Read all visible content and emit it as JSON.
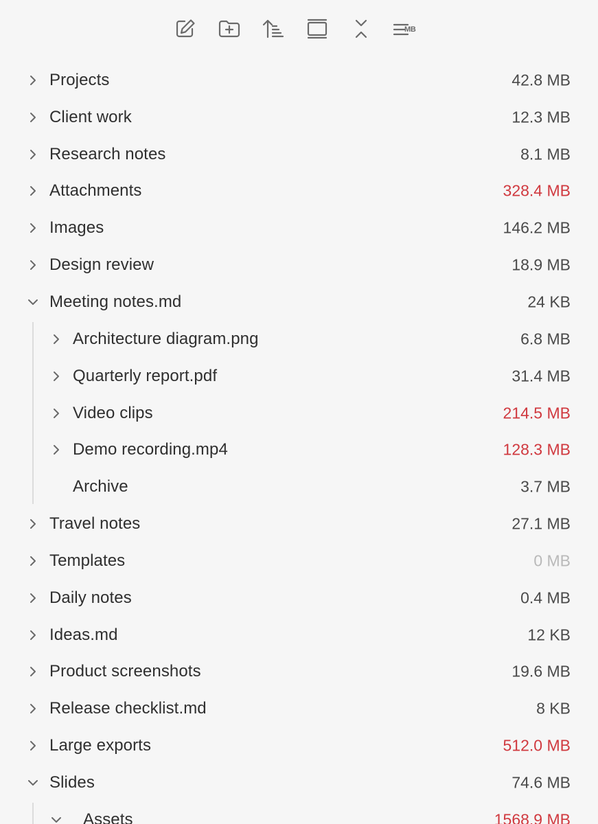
{
  "toolbar": {
    "buttons": [
      {
        "name": "new-note-button",
        "icon": "pencil-square-icon"
      },
      {
        "name": "new-folder-button",
        "icon": "folder-plus-icon"
      },
      {
        "name": "sort-button",
        "icon": "sort-ascending-icon"
      },
      {
        "name": "toggle-view-button",
        "icon": "panel-icon"
      },
      {
        "name": "collapse-all-button",
        "icon": "collapse-icon"
      },
      {
        "name": "size-display-button",
        "icon": "list-mb-icon",
        "badge": "MB"
      }
    ]
  },
  "colors": {
    "background": "#f6f6f6",
    "text": "#2f2f2f",
    "size_normal": "#4a4a4a",
    "size_large": "#d0393f",
    "size_empty": "#b9b9b9",
    "icon": "#6a6a6a"
  },
  "tree": {
    "items": [
      {
        "label": "Projects",
        "size": "42.8 MB",
        "depth": 0,
        "chevron": "right",
        "status": "normal"
      },
      {
        "label": "Client work",
        "size": "12.3 MB",
        "depth": 0,
        "chevron": "right",
        "status": "normal"
      },
      {
        "label": "Research notes",
        "size": "8.1 MB",
        "depth": 0,
        "chevron": "right",
        "status": "normal"
      },
      {
        "label": "Attachments",
        "size": "328.4 MB",
        "depth": 0,
        "chevron": "right",
        "status": "large"
      },
      {
        "label": "Images",
        "size": "146.2 MB",
        "depth": 0,
        "chevron": "right",
        "status": "normal"
      },
      {
        "label": "Design review",
        "size": "18.9 MB",
        "depth": 0,
        "chevron": "right",
        "status": "normal"
      },
      {
        "label": "Meeting notes.md",
        "size": "24 KB",
        "depth": 0,
        "chevron": "down",
        "status": "normal"
      },
      {
        "label": "Architecture diagram.png",
        "size": "6.8 MB",
        "depth": 1,
        "chevron": "right",
        "status": "normal"
      },
      {
        "label": "Quarterly report.pdf",
        "size": "31.4 MB",
        "depth": 1,
        "chevron": "right",
        "status": "normal"
      },
      {
        "label": "Video clips",
        "size": "214.5 MB",
        "depth": 1,
        "chevron": "right",
        "status": "large"
      },
      {
        "label": "Demo recording.mp4",
        "size": "128.3 MB",
        "depth": 1,
        "chevron": "right",
        "status": "large"
      },
      {
        "label": "Archive",
        "size": "3.7 MB",
        "depth": 1,
        "chevron": "none",
        "status": "normal"
      },
      {
        "label": "Travel notes",
        "size": "27.1 MB",
        "depth": 0,
        "chevron": "right",
        "status": "normal"
      },
      {
        "label": "Templates",
        "size": "0 MB",
        "depth": 0,
        "chevron": "right",
        "status": "empty"
      },
      {
        "label": "Daily notes",
        "size": "0.4 MB",
        "depth": 0,
        "chevron": "right",
        "status": "normal"
      },
      {
        "label": "Ideas.md",
        "size": "12 KB",
        "depth": 0,
        "chevron": "right",
        "status": "normal"
      },
      {
        "label": "Product screenshots",
        "size": "19.6 MB",
        "depth": 0,
        "chevron": "right",
        "status": "normal"
      },
      {
        "label": "Release checklist.md",
        "size": "8 KB",
        "depth": 0,
        "chevron": "right",
        "status": "normal"
      },
      {
        "label": "Large exports",
        "size": "512.0 MB",
        "depth": 0,
        "chevron": "right",
        "status": "large"
      },
      {
        "label": "Slides",
        "size": "74.6 MB",
        "depth": 0,
        "chevron": "down",
        "status": "normal"
      },
      {
        "label": "Assets",
        "size": "1568.9 MB",
        "depth": 1,
        "chevron": "down",
        "status": "large"
      }
    ]
  }
}
